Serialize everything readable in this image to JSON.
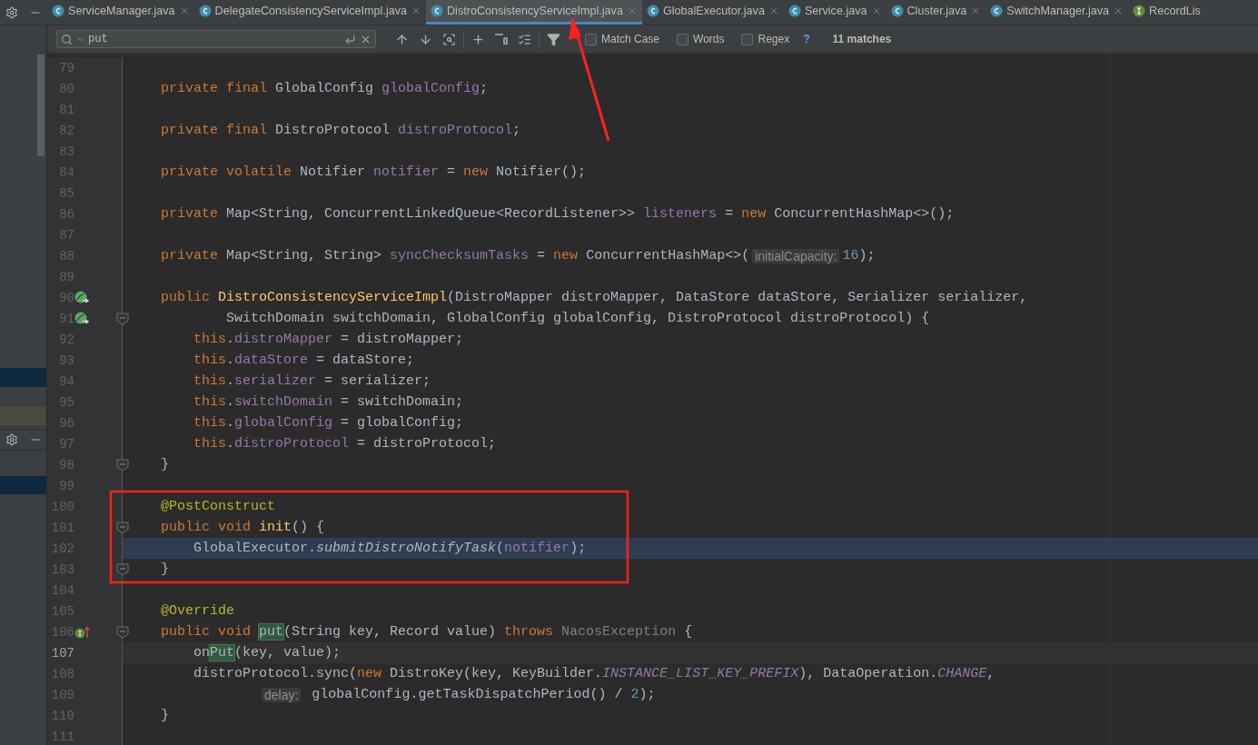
{
  "tabs": [
    {
      "label": "ServiceManager.java",
      "kind": "class",
      "selected": false,
      "closable": true
    },
    {
      "label": "DelegateConsistencyServiceImpl.java",
      "kind": "class",
      "selected": false,
      "closable": true
    },
    {
      "label": "DistroConsistencyServiceImpl.java",
      "kind": "class",
      "selected": true,
      "closable": true
    },
    {
      "label": "GlobalExecutor.java",
      "kind": "class",
      "selected": false,
      "closable": true
    },
    {
      "label": "Service.java",
      "kind": "class",
      "selected": false,
      "closable": true
    },
    {
      "label": "Cluster.java",
      "kind": "class",
      "selected": false,
      "closable": true
    },
    {
      "label": "SwitchManager.java",
      "kind": "class",
      "selected": false,
      "closable": true
    },
    {
      "label": "RecordLis",
      "kind": "interface",
      "selected": false,
      "closable": false
    }
  ],
  "find_bar": {
    "value": "put",
    "options": [
      {
        "label": "Match Case",
        "checked": false
      },
      {
        "label": "Words",
        "checked": false
      },
      {
        "label": "Regex",
        "checked": false
      }
    ],
    "help": "?",
    "matches": "11 matches"
  },
  "lines": [
    {
      "n": "79",
      "kind": "code",
      "selected": false,
      "current": false
    },
    {
      "n": "80",
      "kind": "code",
      "selected": false,
      "current": false,
      "tokens": [
        {
          "kind": "kw",
          "text": "    private final "
        },
        {
          "kind": "plain",
          "text": "GlobalConfig "
        },
        {
          "kind": "field",
          "text": "globalConfig"
        },
        {
          "kind": "plain",
          "text": ";"
        }
      ]
    },
    {
      "n": "81",
      "kind": "code",
      "selected": false,
      "current": false
    },
    {
      "n": "82",
      "kind": "code",
      "selected": false,
      "current": false,
      "tokens": [
        {
          "kind": "kw",
          "text": "    private final "
        },
        {
          "kind": "plain",
          "text": "DistroProtocol "
        },
        {
          "kind": "field",
          "text": "distroProtocol"
        },
        {
          "kind": "plain",
          "text": ";"
        }
      ]
    },
    {
      "n": "83",
      "kind": "code",
      "selected": false,
      "current": false
    },
    {
      "n": "84",
      "kind": "code",
      "selected": false,
      "current": false,
      "tokens": [
        {
          "kind": "kw",
          "text": "    private volatile "
        },
        {
          "kind": "plain",
          "text": "Notifier "
        },
        {
          "kind": "field",
          "text": "notifier"
        },
        {
          "kind": "plain",
          "text": " = "
        },
        {
          "kind": "kw",
          "text": "new "
        },
        {
          "kind": "plain",
          "text": "Notifier();"
        }
      ]
    },
    {
      "n": "85",
      "kind": "code",
      "selected": false,
      "current": false
    },
    {
      "n": "86",
      "kind": "code",
      "selected": false,
      "current": false,
      "tokens": [
        {
          "kind": "kw",
          "text": "    private "
        },
        {
          "kind": "plain",
          "text": "Map<String, ConcurrentLinkedQueue<RecordListener>> "
        },
        {
          "kind": "field",
          "text": "listeners"
        },
        {
          "kind": "plain",
          "text": " = "
        },
        {
          "kind": "kw",
          "text": "new "
        },
        {
          "kind": "plain",
          "text": "ConcurrentHashMap<>();"
        }
      ]
    },
    {
      "n": "87",
      "kind": "code",
      "selected": false,
      "current": false
    },
    {
      "n": "88",
      "kind": "code",
      "selected": false,
      "current": false,
      "tokens": [
        {
          "kind": "kw",
          "text": "    private "
        },
        {
          "kind": "plain",
          "text": "Map<String, String> "
        },
        {
          "kind": "field",
          "text": "syncChecksumTasks"
        },
        {
          "kind": "plain",
          "text": " = "
        },
        {
          "kind": "kw",
          "text": "new "
        },
        {
          "kind": "plain",
          "text": "ConcurrentHashMap<>("
        },
        {
          "kind": "hint",
          "text": "initialCapacity:"
        },
        {
          "kind": "num",
          "text": "16"
        },
        {
          "kind": "plain",
          "text": ");"
        }
      ]
    },
    {
      "n": "89",
      "kind": "code",
      "selected": false,
      "current": false
    },
    {
      "n": "90",
      "kind": "bean",
      "selected": false,
      "current": false,
      "tokens": [
        {
          "kind": "kw",
          "text": "    public "
        },
        {
          "kind": "method",
          "text": "DistroConsistencyServiceImpl"
        },
        {
          "kind": "plain",
          "text": "(DistroMapper distroMapper, DataStore dataStore, Serializer serializer,"
        }
      ]
    },
    {
      "n": "91",
      "kind": "bean",
      "selected": false,
      "current": false,
      "fold": true,
      "tokens": [
        {
          "kind": "plain",
          "text": "            SwitchDomain switchDomain, GlobalConfig globalConfig, DistroProtocol distroProtocol) {"
        }
      ]
    },
    {
      "n": "92",
      "kind": "code",
      "selected": false,
      "current": false,
      "tokens": [
        {
          "kind": "kw",
          "text": "        this"
        },
        {
          "kind": "plain",
          "text": "."
        },
        {
          "kind": "field",
          "text": "distroMapper"
        },
        {
          "kind": "plain",
          "text": " = distroMapper;"
        }
      ]
    },
    {
      "n": "93",
      "kind": "code",
      "selected": false,
      "current": false,
      "tokens": [
        {
          "kind": "kw",
          "text": "        this"
        },
        {
          "kind": "plain",
          "text": "."
        },
        {
          "kind": "field",
          "text": "dataStore"
        },
        {
          "kind": "plain",
          "text": " = dataStore;"
        }
      ]
    },
    {
      "n": "94",
      "kind": "code",
      "selected": false,
      "current": false,
      "tokens": [
        {
          "kind": "kw",
          "text": "        this"
        },
        {
          "kind": "plain",
          "text": "."
        },
        {
          "kind": "field",
          "text": "serializer"
        },
        {
          "kind": "plain",
          "text": " = serializer;"
        }
      ]
    },
    {
      "n": "95",
      "kind": "code",
      "selected": false,
      "current": false,
      "tokens": [
        {
          "kind": "kw",
          "text": "        this"
        },
        {
          "kind": "plain",
          "text": "."
        },
        {
          "kind": "field",
          "text": "switchDomain"
        },
        {
          "kind": "plain",
          "text": " = switchDomain;"
        }
      ]
    },
    {
      "n": "96",
      "kind": "code",
      "selected": false,
      "current": false,
      "tokens": [
        {
          "kind": "kw",
          "text": "        this"
        },
        {
          "kind": "plain",
          "text": "."
        },
        {
          "kind": "field",
          "text": "globalConfig"
        },
        {
          "kind": "plain",
          "text": " = globalConfig;"
        }
      ]
    },
    {
      "n": "97",
      "kind": "code",
      "selected": false,
      "current": false,
      "tokens": [
        {
          "kind": "kw",
          "text": "        this"
        },
        {
          "kind": "plain",
          "text": "."
        },
        {
          "kind": "field",
          "text": "distroProtocol"
        },
        {
          "kind": "plain",
          "text": " = distroProtocol;"
        }
      ]
    },
    {
      "n": "98",
      "kind": "code",
      "selected": false,
      "current": false,
      "fold": true,
      "tokens": [
        {
          "kind": "plain",
          "text": "    }"
        }
      ]
    },
    {
      "n": "99",
      "kind": "code",
      "selected": false,
      "current": false
    },
    {
      "n": "100",
      "kind": "code",
      "selected": false,
      "current": false,
      "tokens": [
        {
          "kind": "ann",
          "text": "    @PostConstruct"
        }
      ]
    },
    {
      "n": "101",
      "kind": "code",
      "selected": false,
      "current": false,
      "fold": true,
      "tokens": [
        {
          "kind": "kw",
          "text": "    public void "
        },
        {
          "kind": "method",
          "text": "init"
        },
        {
          "kind": "plain",
          "text": "() {"
        }
      ]
    },
    {
      "n": "102",
      "kind": "code",
      "selected": true,
      "current": false,
      "tokens": [
        {
          "kind": "plain",
          "text": "        GlobalExecutor."
        },
        {
          "kind": "call",
          "text": "submitDistroNotifyTask"
        },
        {
          "kind": "plain",
          "text": "("
        },
        {
          "kind": "field",
          "text": "notifier"
        },
        {
          "kind": "plain",
          "text": ");"
        }
      ]
    },
    {
      "n": "103",
      "kind": "code",
      "selected": false,
      "current": false,
      "fold": true,
      "tokens": [
        {
          "kind": "plain",
          "text": "    }"
        }
      ]
    },
    {
      "n": "104",
      "kind": "code",
      "selected": false,
      "current": false
    },
    {
      "n": "105",
      "kind": "code",
      "selected": false,
      "current": false,
      "tokens": [
        {
          "kind": "ann",
          "text": "    @Override"
        }
      ]
    },
    {
      "n": "106",
      "kind": "implements",
      "selected": false,
      "current": false,
      "fold": true,
      "tokens": [
        {
          "kind": "kw",
          "text": "    public void "
        },
        {
          "kind": "match",
          "text": "put"
        },
        {
          "kind": "plain",
          "text": "(String key, Record value) "
        },
        {
          "kind": "kw",
          "text": "throws "
        },
        {
          "kind": "dim",
          "text": "NacosException"
        },
        {
          "kind": "plain",
          "text": " {"
        }
      ]
    },
    {
      "n": "107",
      "kind": "code",
      "selected": false,
      "current": true,
      "tokens": [
        {
          "kind": "plain",
          "text": "        on"
        },
        {
          "kind": "match",
          "text": "Put"
        },
        {
          "kind": "plain",
          "text": "(key, value);"
        }
      ]
    },
    {
      "n": "108",
      "kind": "code",
      "selected": false,
      "current": false,
      "tokens": [
        {
          "kind": "plain",
          "text": "        distroProtocol.sync("
        },
        {
          "kind": "kw",
          "text": "new "
        },
        {
          "kind": "plain",
          "text": "DistroKey(key, KeyBuilder."
        },
        {
          "kind": "static",
          "text": "INSTANCE_LIST_KEY_PREFIX"
        },
        {
          "kind": "plain",
          "text": "), DataOperation."
        },
        {
          "kind": "static",
          "text": "CHANGE"
        },
        {
          "kind": "plain",
          "text": ","
        }
      ]
    },
    {
      "n": "109",
      "kind": "continuation",
      "selected": false,
      "current": false,
      "tokens": [
        {
          "kind": "hint",
          "text": "delay:"
        },
        {
          "kind": "plain",
          "text": " globalConfig.getTaskDispatchPeriod() / "
        },
        {
          "kind": "num",
          "text": "2"
        },
        {
          "kind": "plain",
          "text": ");"
        }
      ]
    },
    {
      "n": "110",
      "kind": "code",
      "selected": false,
      "current": false,
      "tokens": [
        {
          "kind": "plain",
          "text": "    }"
        }
      ]
    },
    {
      "n": "111",
      "kind": "code",
      "selected": false,
      "current": false
    }
  ]
}
